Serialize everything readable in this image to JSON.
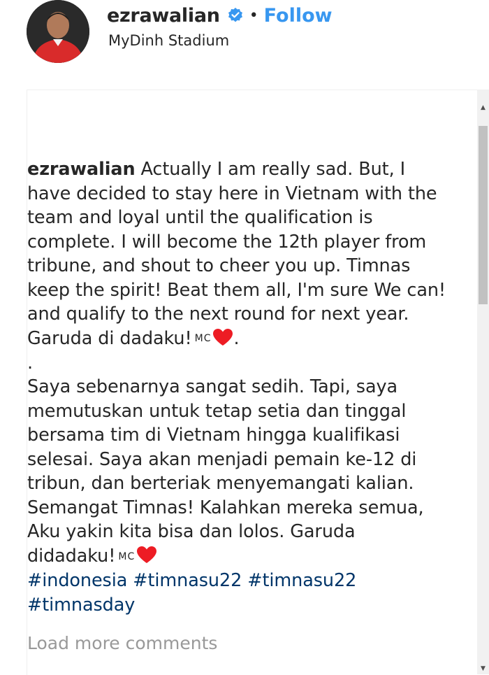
{
  "post": {
    "username": "ezrawalian",
    "verified_icon": "verified-badge-icon",
    "separator": "•",
    "follow_label": "Follow",
    "location": "MyDinh Stadium"
  },
  "caption": {
    "owner": "ezrawalian",
    "english_text": " Actually I am really sad. But, I have decided to stay here in Vietnam with the team and loyal until the qualification is complete. I will become the 12th player from tribune, and shout to cheer you up. Timnas keep the spirit! Beat them all, I'm sure We can! and qualify to the next round for next year. Garuda di dadaku!",
    "mc_label": "MC",
    "english_end": ".",
    "divider": ".",
    "indonesian_text": "Saya sebenarnya sangat sedih. Tapi, saya memutuskan untuk tetap setia dan tinggal bersama tim di Vietnam hingga kualifikasi selesai. Saya akan menjadi pemain ke-12 di tribun, dan berteriak menyemangati kalian. Semangat Timnas! Kalahkan mereka semua, Aku yakin kita bisa dan lolos. Garuda didadaku!",
    "hashtags": [
      "#indonesia",
      "#timnasu22",
      "#timnasu22",
      "#timnasday"
    ]
  },
  "comments": {
    "load_more_label": "Load more comments"
  },
  "colors": {
    "follow": "#3897f0",
    "hashtag": "#003569",
    "heart": "#ed1c24",
    "muted": "#999999"
  }
}
